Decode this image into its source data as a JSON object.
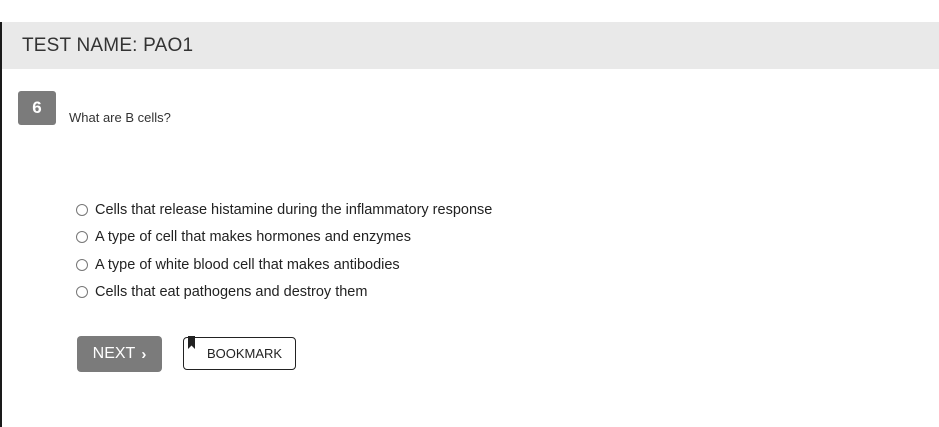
{
  "header": {
    "test_name": "TEST NAME:  PAO1"
  },
  "question": {
    "number": "6",
    "text": "What are B cells?"
  },
  "answers": [
    {
      "label": "Cells that release histamine during the inflammatory response"
    },
    {
      "label": "A type of cell that makes hormones and enzymes"
    },
    {
      "label": "A type of white blood cell that makes antibodies"
    },
    {
      "label": "Cells that eat pathogens and destroy them"
    }
  ],
  "actions": {
    "next_label": "NEXT",
    "next_icon": "chevron-right-icon",
    "bookmark_label": "BOOKMARK",
    "bookmark_icon": "bookmark-icon"
  },
  "colors": {
    "header_bg": "#e9e9e9",
    "badge_bg": "#7b7b7b",
    "next_bg": "#7b7b7b"
  }
}
